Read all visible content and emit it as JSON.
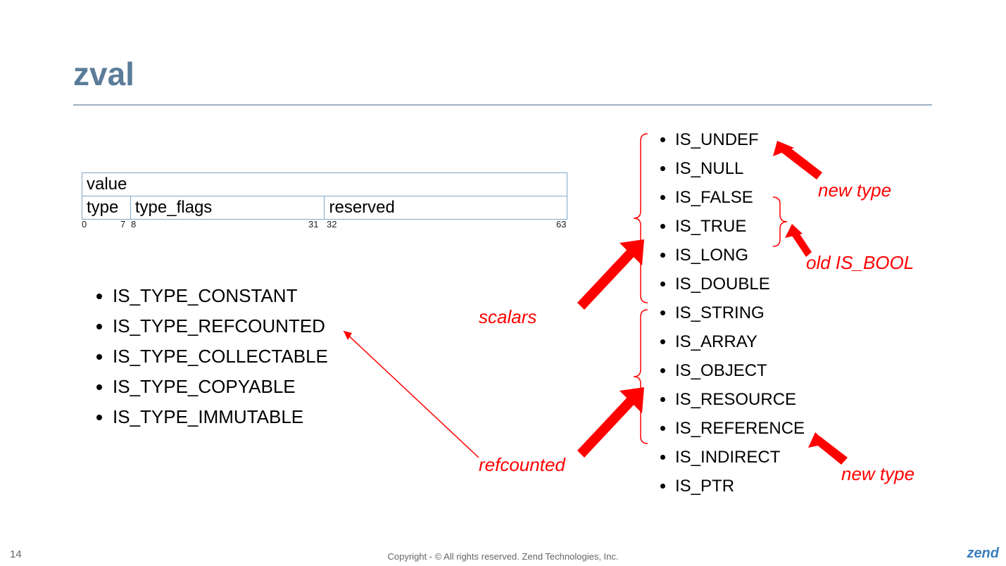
{
  "title": "zval",
  "struct": {
    "row1": "value",
    "row2": {
      "c1": "type",
      "c2": "type_flags",
      "c3": "reserved"
    },
    "bits": {
      "b0": "0",
      "b7": "7",
      "b8": "8",
      "b31": "31",
      "b32": "32",
      "b63": "63"
    }
  },
  "typeFlags": [
    "IS_TYPE_CONSTANT",
    "IS_TYPE_REFCOUNTED",
    "IS_TYPE_COLLECTABLE",
    "IS_TYPE_COPYABLE",
    "IS_TYPE_IMMUTABLE"
  ],
  "types": [
    "IS_UNDEF",
    "IS_NULL",
    "IS_FALSE",
    "IS_TRUE",
    "IS_LONG",
    "IS_DOUBLE",
    "IS_STRING",
    "IS_ARRAY",
    "IS_OBJECT",
    "IS_RESOURCE",
    "IS_REFERENCE",
    "IS_INDIRECT",
    "IS_PTR"
  ],
  "annotations": {
    "scalars": "scalars",
    "refcounted": "refcounted",
    "newtype1": "new type",
    "newtype2": "new type",
    "oldbool": "old IS_BOOL"
  },
  "footer": {
    "page": "14",
    "copyright": "Copyright - © All rights reserved. Zend Technologies, Inc.",
    "logo": "zend"
  }
}
